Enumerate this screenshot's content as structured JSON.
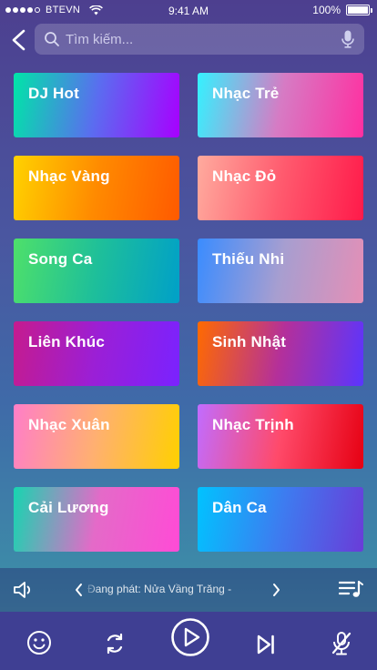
{
  "status_bar": {
    "carrier": "BTEVN",
    "time": "9:41 AM",
    "battery": "100%",
    "signal_bars": 4
  },
  "search": {
    "placeholder": "Tìm kiếm..."
  },
  "categories": [
    {
      "label": "DJ Hot",
      "gradient": [
        "#00e5a8",
        "#5b6cf0",
        "#a700ff"
      ]
    },
    {
      "label": "Nhạc Trẻ",
      "gradient": [
        "#34f2ff",
        "#d67bc4",
        "#ff2fa0"
      ]
    },
    {
      "label": "Nhạc Vàng",
      "gradient": [
        "#ffd200",
        "#ff8a00",
        "#ff5a00"
      ]
    },
    {
      "label": "Nhạc Đỏ",
      "gradient": [
        "#ffab9e",
        "#ff5a6e",
        "#ff1a4a"
      ]
    },
    {
      "label": "Song Ca",
      "gradient": [
        "#4ee06a",
        "#1ebf9a",
        "#00a0c8"
      ]
    },
    {
      "label": "Thiếu Nhi",
      "gradient": [
        "#3a8cff",
        "#a79ed0",
        "#e58fb6"
      ]
    },
    {
      "label": "Liên Khúc",
      "gradient": [
        "#c51b8e",
        "#9b1fd6",
        "#7a22ff"
      ]
    },
    {
      "label": "Sinh Nhật",
      "gradient": [
        "#ff6a00",
        "#b4309a",
        "#5a35ff"
      ]
    },
    {
      "label": "Nhạc Xuân",
      "gradient": [
        "#ff7ec8",
        "#ffb070",
        "#ffd000"
      ]
    },
    {
      "label": "Nhạc Trịnh",
      "gradient": [
        "#c16cff",
        "#ff4a6a",
        "#e60012"
      ]
    },
    {
      "label": "Cải Lương",
      "gradient": [
        "#17d5b0",
        "#e46ac8",
        "#ff4bd6"
      ]
    },
    {
      "label": "Dân Ca",
      "gradient": [
        "#00c3ff",
        "#3d7cf0",
        "#6a3cd8"
      ]
    }
  ],
  "player": {
    "now_playing": "Đang phát: Nửa Vầng Trăng - "
  },
  "colors": {
    "controls_bg": "#3f3f93",
    "accent": "#ffffff"
  }
}
